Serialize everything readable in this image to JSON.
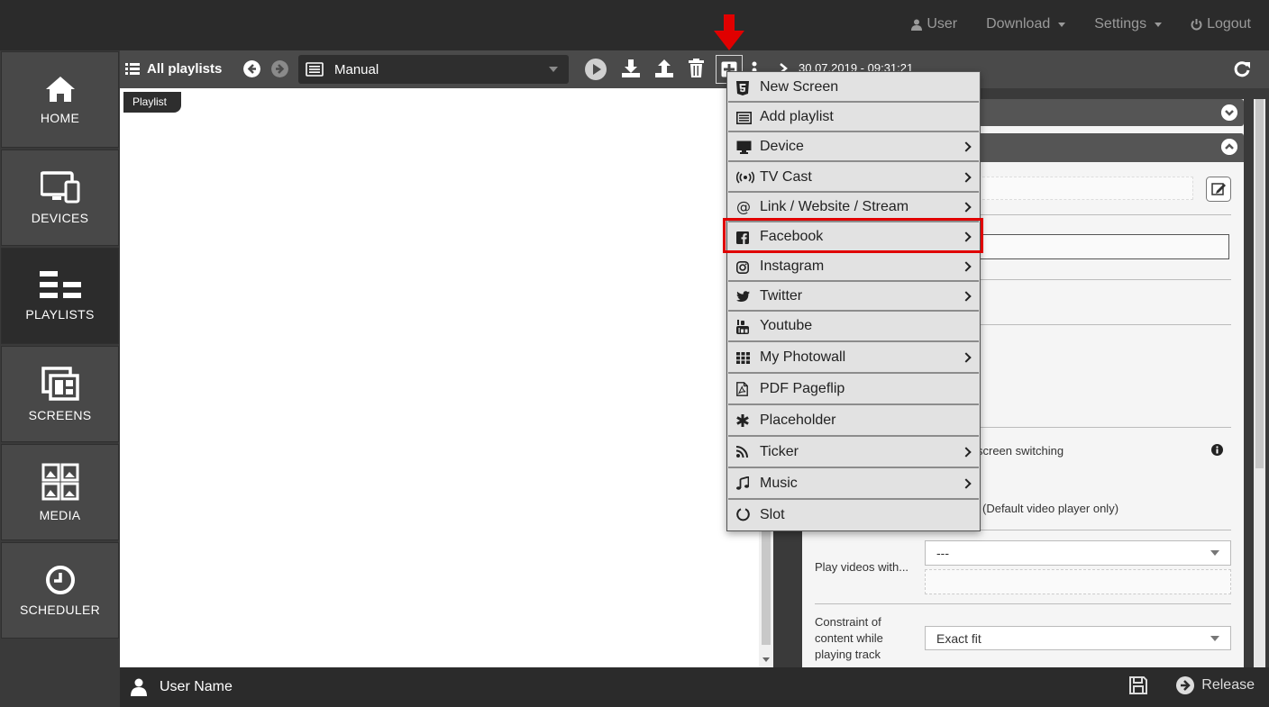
{
  "topbar": {
    "user": "User",
    "download": "Download",
    "settings": "Settings",
    "logout": "Logout"
  },
  "sidebar": {
    "items": [
      {
        "label": "HOME",
        "icon": "home-icon"
      },
      {
        "label": "DEVICES",
        "icon": "devices-icon"
      },
      {
        "label": "PLAYLISTS",
        "icon": "playlists-icon",
        "active": true
      },
      {
        "label": "SCREENS",
        "icon": "screens-icon"
      },
      {
        "label": "MEDIA",
        "icon": "media-icon"
      },
      {
        "label": "SCHEDULER",
        "icon": "clock-icon"
      }
    ]
  },
  "playlist_header": {
    "all_playlists": "All playlists",
    "selected_playlist": "Manual",
    "tag": "Playlist"
  },
  "right_panel": {
    "date": "30.07.2019 - 09:31:21",
    "switching_text": "screen switching",
    "video_player_text": "(Default video player only)",
    "play_videos_label": "Play videos with...",
    "play_videos_value": "---",
    "constraint_label_1": "Constraint of",
    "constraint_label_2": "content while",
    "constraint_label_3": "playing track",
    "constraint_value": "Exact fit"
  },
  "bottombar": {
    "user_name": "User Name",
    "release": "Release"
  },
  "menu": {
    "items": [
      {
        "label": "New Screen",
        "icon": "html5-icon",
        "submenu": false
      },
      {
        "label": "Add playlist",
        "icon": "list-icon",
        "submenu": false
      },
      {
        "label": "Device",
        "icon": "monitor-icon",
        "submenu": true
      },
      {
        "label": "TV Cast",
        "icon": "broadcast-icon",
        "submenu": true
      },
      {
        "label": "Link / Website / Stream",
        "icon": "at-icon",
        "submenu": true
      },
      {
        "label": "Facebook",
        "icon": "facebook-icon",
        "submenu": true,
        "highlighted": true
      },
      {
        "label": "Instagram",
        "icon": "instagram-icon",
        "submenu": true
      },
      {
        "label": "Twitter",
        "icon": "twitter-icon",
        "submenu": true
      },
      {
        "label": "Youtube",
        "icon": "youtube-icon",
        "submenu": false
      },
      {
        "label": "My Photowall",
        "icon": "grid-icon",
        "submenu": true
      },
      {
        "label": "PDF Pageflip",
        "icon": "pdf-icon",
        "submenu": false
      },
      {
        "label": "Placeholder",
        "icon": "asterisk-icon",
        "submenu": false
      },
      {
        "label": "Ticker",
        "icon": "rss-icon",
        "submenu": true
      },
      {
        "label": "Music",
        "icon": "music-icon",
        "submenu": true
      },
      {
        "label": "Slot",
        "icon": "circle-icon",
        "submenu": false
      }
    ]
  },
  "colors": {
    "highlight": "#e00000",
    "arrow": "#e00000",
    "topbar": "#2b2b2b",
    "sidebar_item": "#484848",
    "sidebar_active": "#2c2c2c"
  }
}
